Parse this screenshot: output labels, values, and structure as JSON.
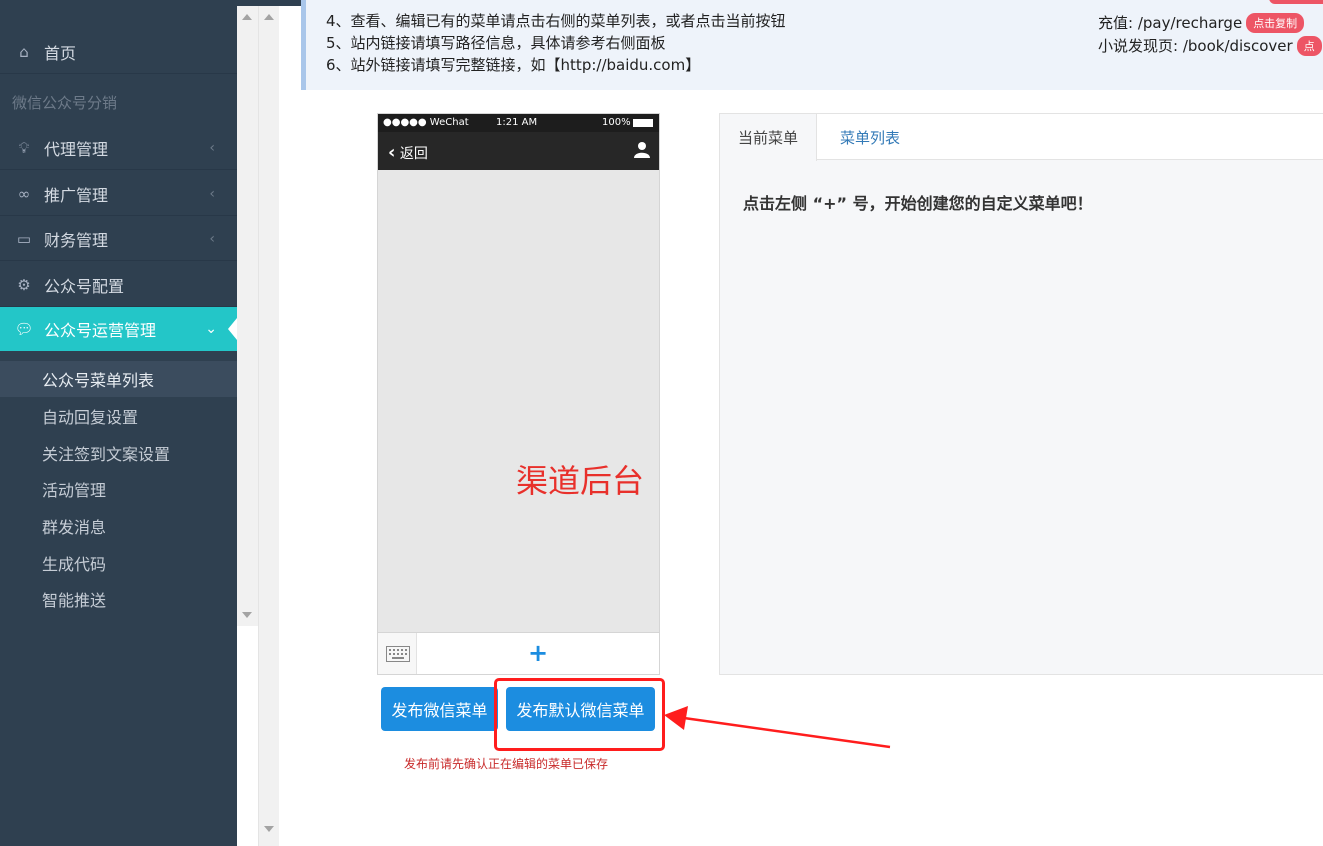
{
  "sidebar": {
    "home": "首页",
    "group_label": "微信公众号分销",
    "items": [
      {
        "label": "代理管理",
        "icon": "lightbulb-icon"
      },
      {
        "label": "推广管理",
        "icon": "link-icon"
      },
      {
        "label": "财务管理",
        "icon": "wallet-icon"
      },
      {
        "label": "公众号配置",
        "icon": "gear-icon"
      },
      {
        "label": "公众号运营管理",
        "icon": "chat-icon"
      }
    ],
    "subitems": [
      "公众号菜单列表",
      "自动回复设置",
      "关注签到文案设置",
      "活动管理",
      "群发消息",
      "生成代码",
      "智能推送"
    ]
  },
  "notice": {
    "line4": "4、查看、编辑已有的菜单请点击右侧的菜单列表，或者点击当前按钮",
    "line5": "5、站内链接请填写路径信息，具体请参考右侧面板",
    "line6": "6、站外链接请填写完整链接，如【http://baidu.com】",
    "recharge": "充值: /pay/recharge",
    "discover": "小说发现页: /book/discover",
    "copy_badge": "点击复制",
    "copy_badge_cut": "点"
  },
  "phone": {
    "carrier": "●●●●● WeChat",
    "time": "1:21 AM",
    "battery": "100%",
    "back": "返回",
    "add": "+"
  },
  "annotation_label": "渠道后台",
  "panel": {
    "tab_current": "当前菜单",
    "tab_list": "菜单列表",
    "message": "点击左侧 “+” 号，开始创建您的自定义菜单吧！"
  },
  "buttons": {
    "publish": "发布微信菜单",
    "publish_default": "发布默认微信菜单"
  },
  "hint": "发布前请先确认正在编辑的菜单已保存",
  "colors": {
    "sidebar_bg": "#2f4050",
    "active": "#23c6c8",
    "primary": "#1c8de0",
    "danger": "#ed5565",
    "annotation": "#ff1d1d"
  }
}
